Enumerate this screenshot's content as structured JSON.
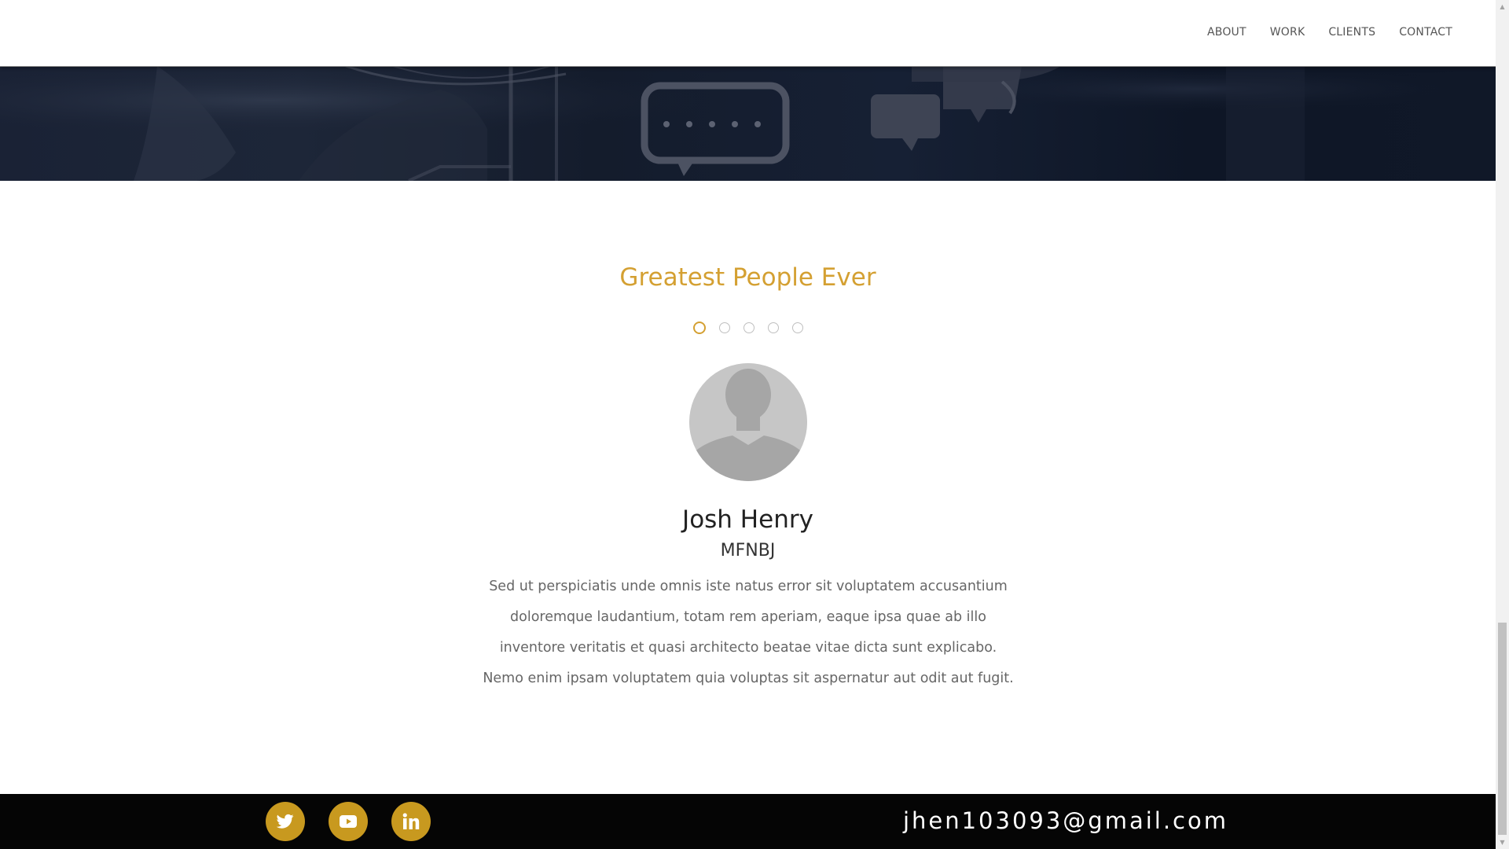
{
  "nav": {
    "items": [
      {
        "label": "ABOUT"
      },
      {
        "label": "WORK"
      },
      {
        "label": "CLIENTS"
      },
      {
        "label": "CONTACT"
      }
    ]
  },
  "testimonials": {
    "title": "Greatest People Ever",
    "slide_count": 5,
    "active_slide": 1,
    "person": {
      "name": "Josh Henry",
      "organization": "MFNBJ",
      "quote": "Sed ut perspiciatis unde omnis iste natus error sit voluptatem accusantium doloremque laudantium, totam rem aperiam, eaque ipsa quae ab illo inventore veritatis et quasi architecto beatae vitae dicta sunt explicabo. Nemo enim ipsam voluptatem quia voluptas sit aspernatur aut odit aut fugit."
    }
  },
  "footer": {
    "social": [
      {
        "icon": "twitter-icon"
      },
      {
        "icon": "youtube-icon"
      },
      {
        "icon": "linkedin-icon"
      }
    ],
    "email": "jhen103093@gmail.com"
  },
  "colors": {
    "accent": "#d4a032",
    "social_bg": "#c8991f",
    "footer_bg": "#050505"
  }
}
